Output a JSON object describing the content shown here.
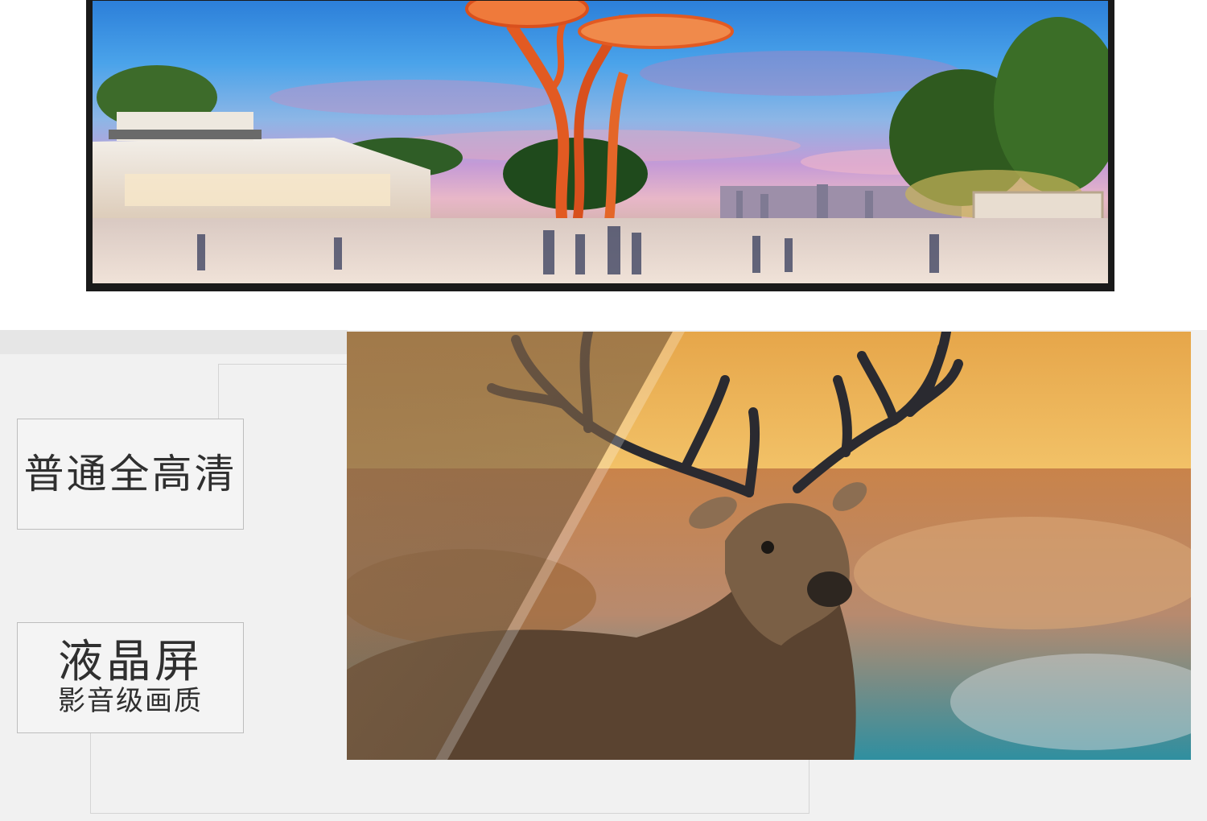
{
  "comparison": {
    "normal_label": "普通全高清",
    "lcd_label": "液晶屏",
    "lcd_sublabel": "影音级画质"
  },
  "images": {
    "top_scene": "city-plaza-night-sculpture",
    "comparison_scene": "red-deer-sunset"
  },
  "colors": {
    "frame": "#1a1a1a",
    "label_text": "#2f2f2f",
    "label_border": "#bdbdbd",
    "section_bg": "#f1f1f1",
    "sculpture": "#e25a22"
  }
}
